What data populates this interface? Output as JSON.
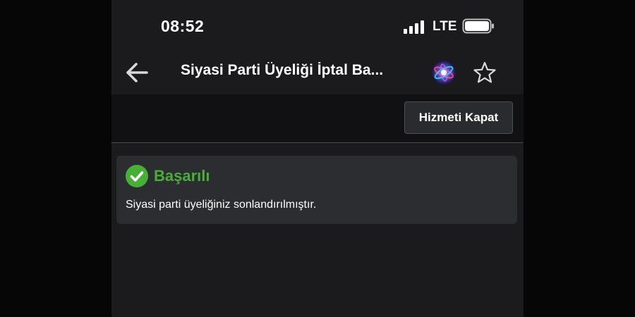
{
  "status_bar": {
    "time": "08:52",
    "network": "LTE",
    "signal_icon": "signal-bars-icon",
    "battery_icon": "battery-icon"
  },
  "nav": {
    "back_icon": "arrow-left-icon",
    "title": "Siyasi Parti Üyeliği İptal Ba...",
    "siri_icon": "siri-icon",
    "favorite_icon": "star-outline-icon"
  },
  "toolbar": {
    "close_service_label": "Hizmeti Kapat"
  },
  "result": {
    "icon": "check-circle-icon",
    "title": "Başarılı",
    "message": "Siyasi parti üyeliğiniz sonlandırılmıştır."
  },
  "colors": {
    "success": "#46b035",
    "background": "#1b1b1d",
    "card": "#2c2d31",
    "text": "#ffffff"
  }
}
